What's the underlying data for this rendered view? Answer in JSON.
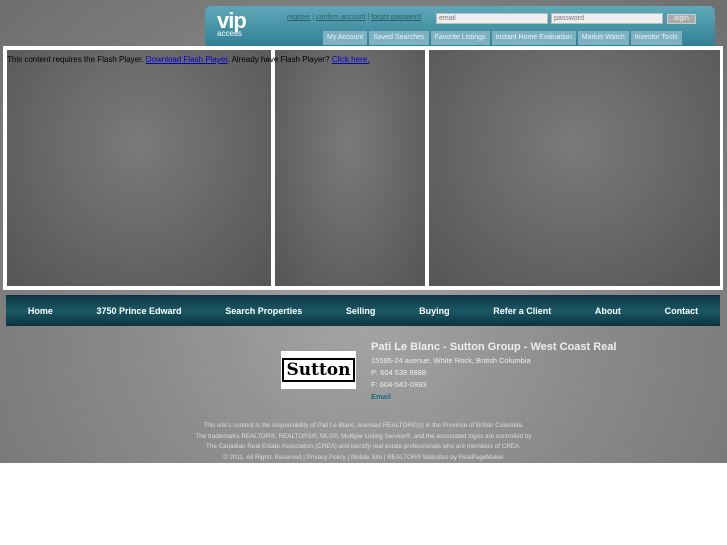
{
  "header": {
    "logo": "vip",
    "logo_sub": "access",
    "links": [
      "register",
      "confirm account",
      "forgot password"
    ],
    "email_placeholder": "email",
    "password_placeholder": "password",
    "login_label": "login",
    "tabs": [
      "My Account",
      "Saved Searches",
      "Favorite Listings",
      "Instant Home Evaluation",
      "Market Watch",
      "Investor Tools"
    ]
  },
  "flash": {
    "text1": "This content requires the Flash Player. ",
    "link1": "Download Flash Player",
    "text2": ". Already have Flash Player? ",
    "link2": "Click here."
  },
  "nav": [
    "Home",
    "3750 Prince Edward",
    "Search Properties",
    "Selling",
    "Buying",
    "Refer a Client",
    "About",
    "Contact"
  ],
  "footer": {
    "logo": "Sutton",
    "title": "Pati Le Blanc - Sutton Group - West Coast Real",
    "address": "15595-24 avenue, White Rock, British Columbia",
    "phone": "P: 604 538 8888",
    "fax": "F: 604-542-0993",
    "email": "Email",
    "legal": [
      "This site's content is the responsibility of Pati Le Blanc, licensed REALTOR®(s) in the Province of British Columbia.",
      "The trademarks REALTOR®, REALTORS®, MLS®, Multiple Listing Service®, and the associated logos are controlled by",
      "The Canadian Real Estate Association (CREA) and identify real estate professionals who are members of CREA.",
      "© 2011. All Rights Reserved | Privacy Policy | Mobile Site | REALTOR® Websites by RealPageMaker"
    ]
  }
}
